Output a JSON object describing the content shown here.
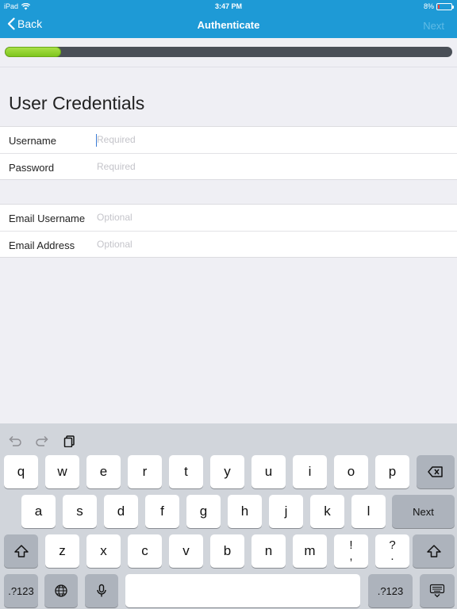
{
  "status": {
    "device": "iPad",
    "time": "3:47 PM",
    "battery": "8%"
  },
  "nav": {
    "back_label": "Back",
    "title": "Authenticate",
    "next_label": "Next"
  },
  "progress": {
    "value": 0.125
  },
  "section": {
    "title": "User Credentials"
  },
  "credentials": [
    {
      "label": "Username",
      "placeholder": "Required"
    },
    {
      "label": "Password",
      "placeholder": "Required"
    }
  ],
  "email": [
    {
      "label": "Email Username",
      "placeholder": "Optional"
    },
    {
      "label": "Email Address",
      "placeholder": "Optional"
    }
  ],
  "keyboard": {
    "row1": [
      "q",
      "w",
      "e",
      "r",
      "t",
      "y",
      "u",
      "i",
      "o",
      "p"
    ],
    "row2": [
      "a",
      "s",
      "d",
      "f",
      "g",
      "h",
      "j",
      "k",
      "l"
    ],
    "row3": [
      "z",
      "x",
      "c",
      "v",
      "b",
      "n",
      "m"
    ],
    "row3_punct": [
      {
        "top": "!",
        "bottom": ","
      },
      {
        "top": "?",
        "bottom": "."
      }
    ],
    "next_label": "Next",
    "numbers_label": ".?123"
  },
  "colors": {
    "nav": "#1e9ad6",
    "progress": "#7ec51d",
    "track": "#4a4f57"
  }
}
